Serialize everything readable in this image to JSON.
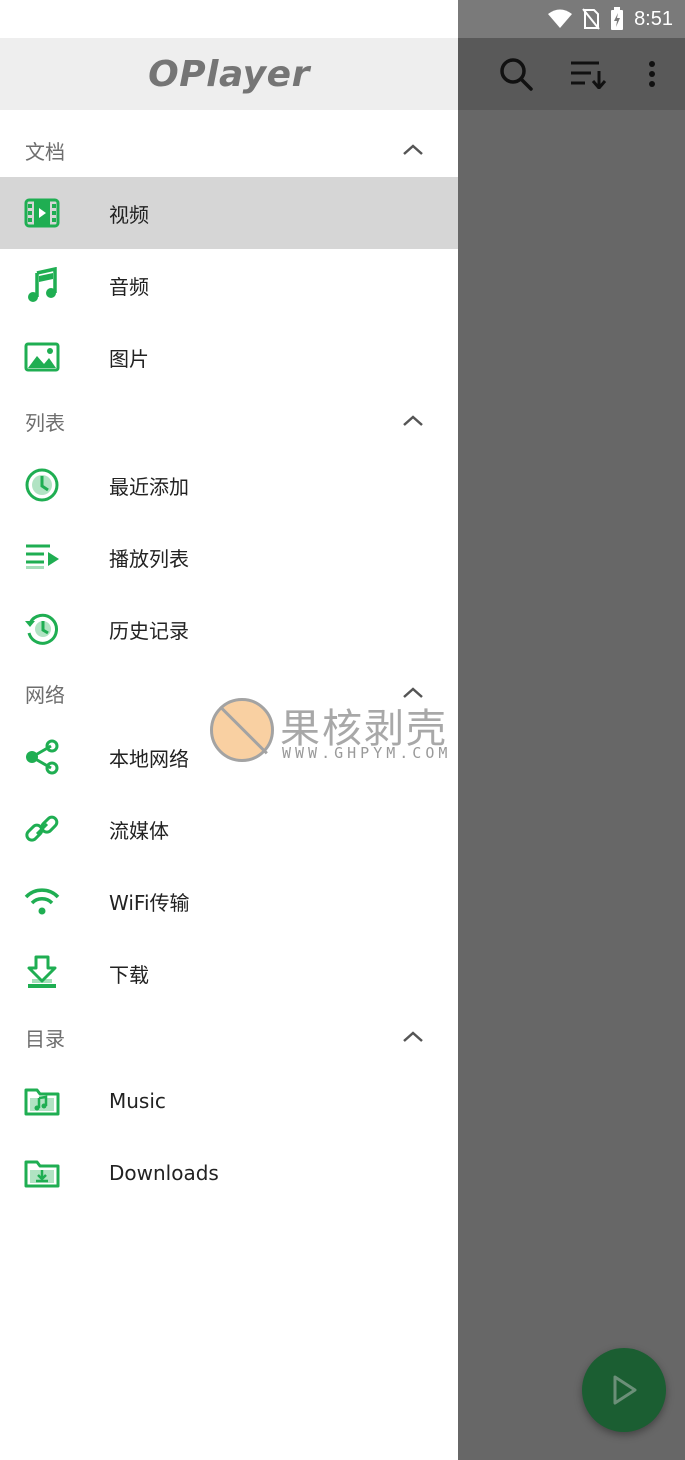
{
  "status_bar": {
    "time": "8:51"
  },
  "drawer": {
    "app_name": "OPlayer",
    "sections": [
      {
        "label": "文档",
        "items": [
          {
            "label": "视频",
            "icon": "video-icon",
            "active": true
          },
          {
            "label": "音频",
            "icon": "music-note-icon"
          },
          {
            "label": "图片",
            "icon": "image-icon"
          }
        ]
      },
      {
        "label": "列表",
        "items": [
          {
            "label": "最近添加",
            "icon": "clock-icon"
          },
          {
            "label": "播放列表",
            "icon": "playlist-icon"
          },
          {
            "label": "历史记录",
            "icon": "history-icon"
          }
        ]
      },
      {
        "label": "网络",
        "items": [
          {
            "label": "本地网络",
            "icon": "share-icon"
          },
          {
            "label": "流媒体",
            "icon": "link-icon"
          },
          {
            "label": "WiFi传输",
            "icon": "wifi-icon"
          },
          {
            "label": "下载",
            "icon": "download-icon"
          }
        ]
      },
      {
        "label": "目录",
        "items": [
          {
            "label": "Music",
            "icon": "music-folder-icon"
          },
          {
            "label": "Downloads",
            "icon": "download-folder-icon"
          }
        ]
      }
    ]
  },
  "watermark": {
    "text": "果核剥壳",
    "url": "WWW.GHPYM.COM"
  },
  "colors": {
    "accent": "#1fae52",
    "header_bg": "#eeeeee",
    "active_bg": "#d6d6d6",
    "scrim": "#676767",
    "fab": "#1b5e32"
  }
}
